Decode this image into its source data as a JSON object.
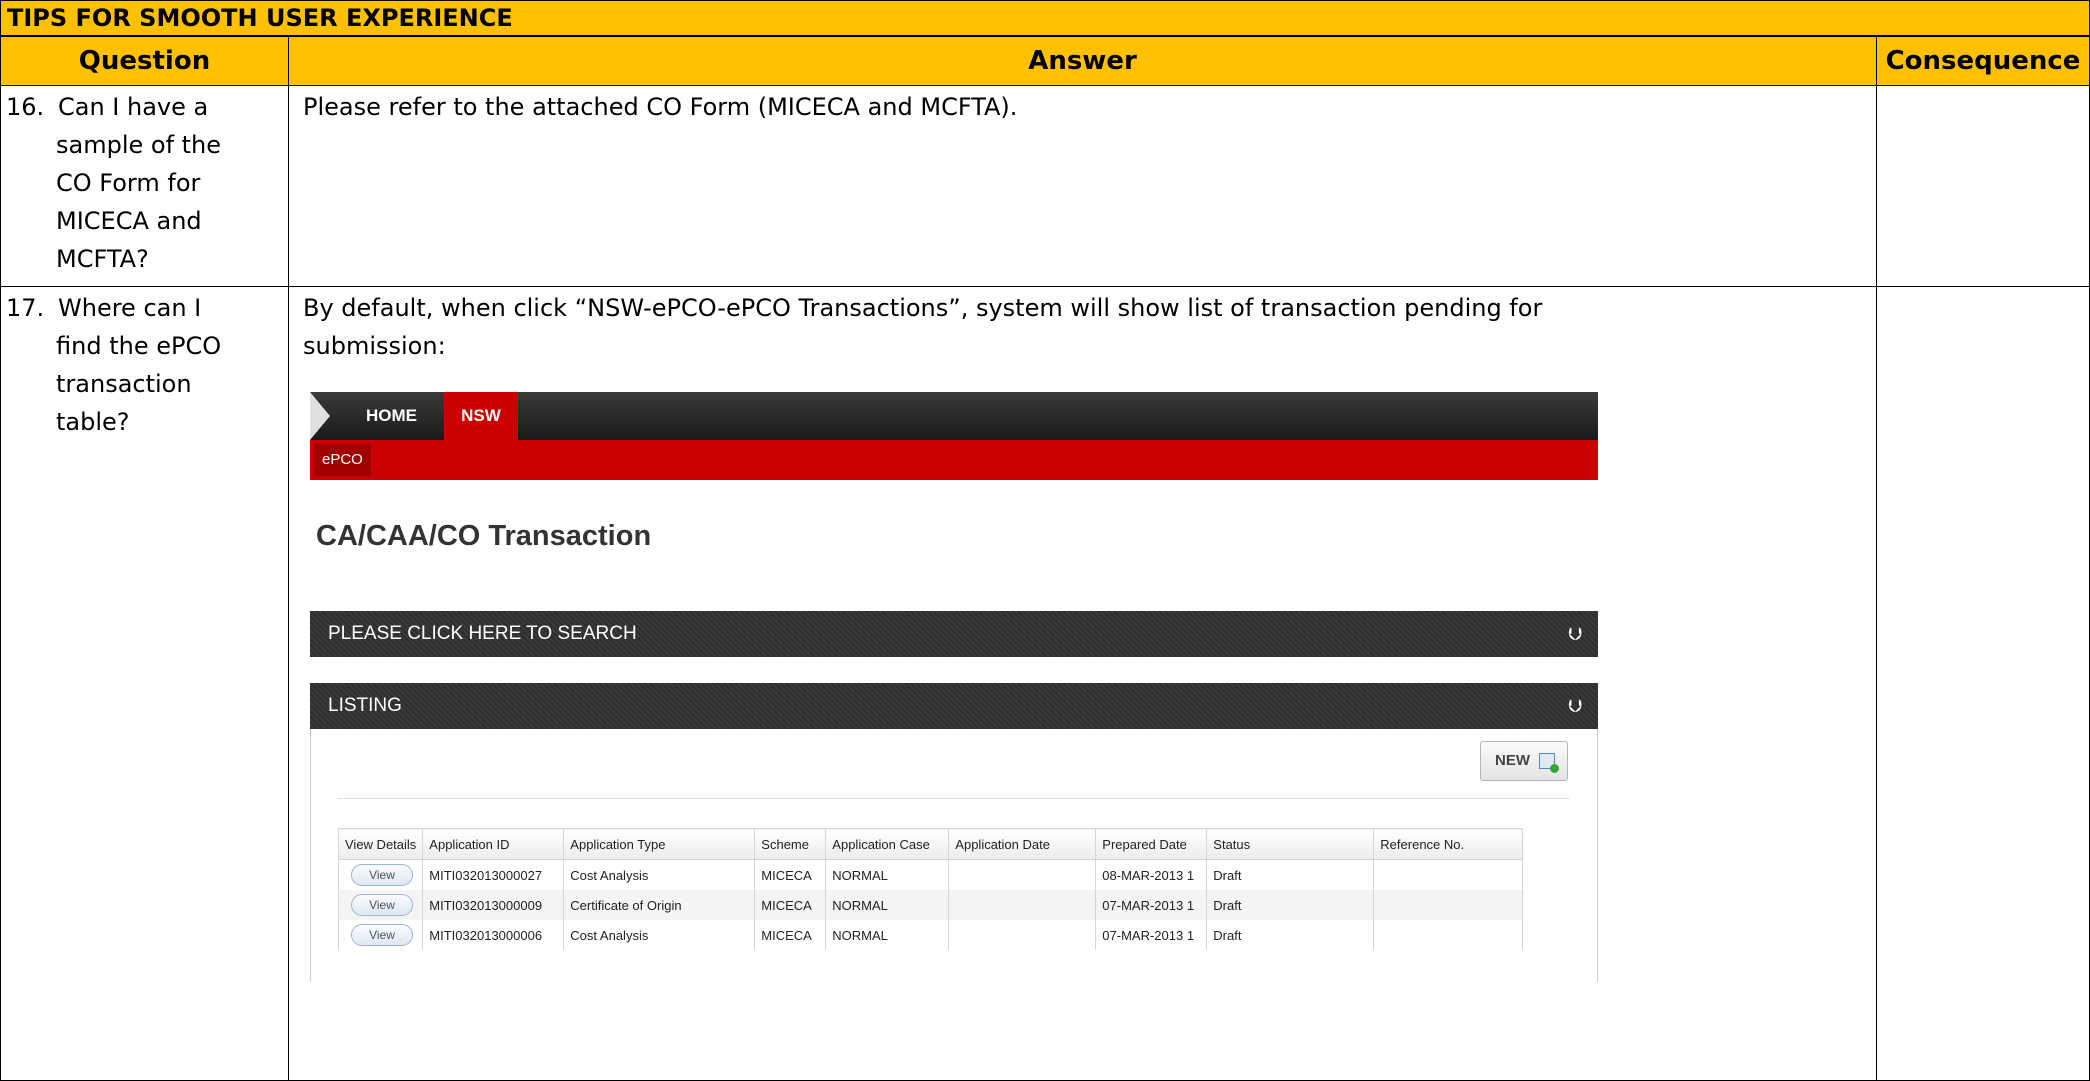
{
  "doc": {
    "title": "TIPS FOR SMOOTH USER EXPERIENCE",
    "headers": {
      "question": "Question",
      "answer": "Answer",
      "consequence": "Consequence"
    },
    "rows": [
      {
        "number": "16.",
        "question_lines": [
          "Can I have a",
          "sample of the",
          "CO Form for",
          "MICECA and",
          "MCFTA?"
        ],
        "answer": "Please refer to the attached CO Form (MICECA and MCFTA).",
        "consequence": ""
      },
      {
        "number": "17.",
        "question_lines": [
          "Where can I",
          "find the ePCO",
          "transaction",
          "table?"
        ],
        "answer_line1": "By default, when click “NSW-ePCO-ePCO Transactions”, system will show list of transaction pending for",
        "answer_line2": "submission:",
        "consequence": ""
      }
    ]
  },
  "screenshot": {
    "nav": {
      "home": "HOME",
      "active": "NSW",
      "sub_item": "ePCO",
      "accent_color": "#cc0000"
    },
    "page_title": "CA/CAA/CO Transaction",
    "search_panel": {
      "label": "PLEASE CLICK HERE TO SEARCH"
    },
    "listing_panel": {
      "label": "LISTING"
    },
    "new_button": {
      "label": "NEW"
    },
    "table": {
      "columns": [
        "View Details",
        "Application ID",
        "Application Type",
        "Scheme",
        "Application Case",
        "Application Date",
        "Prepared Date",
        "Status",
        "Reference No."
      ],
      "rows": [
        {
          "view": "View",
          "id": "MITI032013000027",
          "type": "Cost Analysis",
          "scheme": "MICECA",
          "case": "NORMAL",
          "app_date": "",
          "prepared": "08-MAR-2013 1",
          "status": "Draft",
          "ref": ""
        },
        {
          "view": "View",
          "id": "MITI032013000009",
          "type": "Certificate of Origin",
          "scheme": "MICECA",
          "case": "NORMAL",
          "app_date": "",
          "prepared": "07-MAR-2013 1",
          "status": "Draft",
          "ref": ""
        },
        {
          "view": "View",
          "id": "MITI032013000006",
          "type": "Cost Analysis",
          "scheme": "MICECA",
          "case": "NORMAL",
          "app_date": "",
          "prepared": "07-MAR-2013 1",
          "status": "Draft",
          "ref": ""
        }
      ]
    }
  }
}
